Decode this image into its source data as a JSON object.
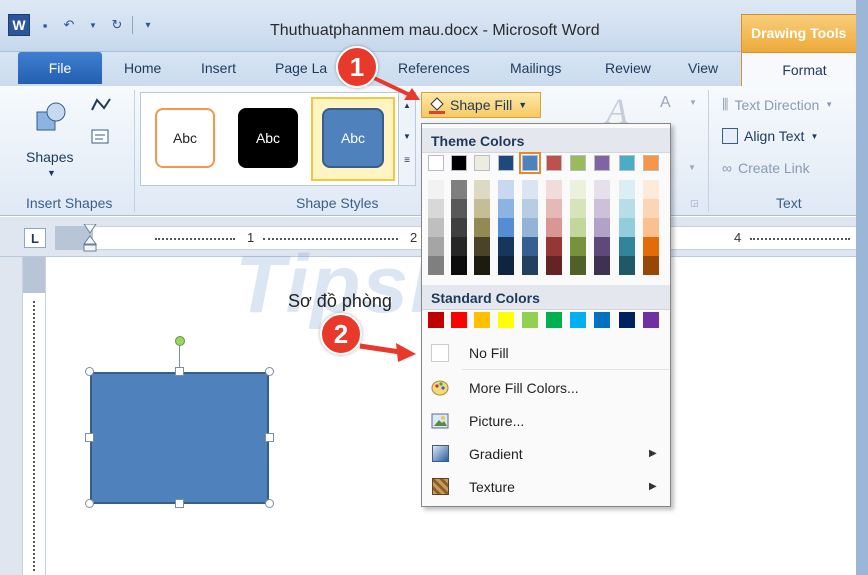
{
  "window": {
    "title": "Thuthuatphanmem mau.docx - Microsoft Word",
    "word_logo": "W"
  },
  "contextual_tab": {
    "label": "Drawing Tools"
  },
  "tabs": [
    {
      "label": "File"
    },
    {
      "label": "Home"
    },
    {
      "label": "Insert"
    },
    {
      "label": "Page La"
    },
    {
      "label": "References"
    },
    {
      "label": "Mailings"
    },
    {
      "label": "Review"
    },
    {
      "label": "View"
    },
    {
      "label": "Format"
    }
  ],
  "ribbon": {
    "insert_shapes": {
      "shapes_label": "Shapes",
      "group_label": "Insert Shapes"
    },
    "shape_styles": {
      "group_label": "Shape Styles",
      "styles": [
        {
          "label": "Abc"
        },
        {
          "label": "Abc"
        },
        {
          "label": "Abc"
        }
      ],
      "shape_fill_label": "Shape Fill"
    },
    "text": {
      "text_direction": "Text Direction",
      "align_text": "Align Text",
      "create_link": "Create Link",
      "group_label": "Text"
    }
  },
  "ruler_numbers": [
    "1",
    "2",
    "4"
  ],
  "document": {
    "heading": "Sơ đồ phòng"
  },
  "shape_fill_menu": {
    "theme_colors_label": "Theme Colors",
    "standard_colors_label": "Standard Colors",
    "theme_colors": [
      [
        "#ffffff",
        "#f2f2f2",
        "#d8d8d8",
        "#bfbfbf",
        "#a5a5a5",
        "#7f7f7f"
      ],
      [
        "#000000",
        "#7f7f7f",
        "#595959",
        "#3f3f3f",
        "#262626",
        "#0c0c0c"
      ],
      [
        "#eeece1",
        "#ddd9c3",
        "#c4bd97",
        "#938953",
        "#494429",
        "#1d1b10"
      ],
      [
        "#1f497d",
        "#c6d9f0",
        "#8db3e2",
        "#548dd4",
        "#17365d",
        "#0f243e"
      ],
      [
        "#4f81bd",
        "#dbe5f1",
        "#b8cce4",
        "#95b3d7",
        "#366092",
        "#244061"
      ],
      [
        "#c0504d",
        "#f2dcdb",
        "#e5b9b7",
        "#d99694",
        "#953734",
        "#632423"
      ],
      [
        "#9bbb59",
        "#ebf1dd",
        "#d7e3bc",
        "#c3d69b",
        "#76923c",
        "#4f6128"
      ],
      [
        "#8064a2",
        "#e5e0ec",
        "#ccc1d9",
        "#b2a2c7",
        "#5f497a",
        "#3f3151"
      ],
      [
        "#4bacc6",
        "#dbeef3",
        "#b7dde8",
        "#92cddc",
        "#31859b",
        "#205867"
      ],
      [
        "#f79646",
        "#fdeada",
        "#fbd5b5",
        "#fac08f",
        "#e36c09",
        "#974806"
      ]
    ],
    "standard_colors": [
      "#c00000",
      "#ff0000",
      "#ffc000",
      "#ffff00",
      "#92d050",
      "#00b050",
      "#00b0f0",
      "#0070c0",
      "#002060",
      "#7030a0"
    ],
    "items": [
      {
        "label": "No Fill",
        "icon": "no-fill-icon"
      },
      {
        "label": "More Fill Colors...",
        "icon": "palette-icon"
      },
      {
        "label": "Picture...",
        "icon": "picture-icon"
      },
      {
        "label": "Gradient",
        "icon": "gradient-icon"
      },
      {
        "label": "Texture",
        "icon": "texture-icon"
      }
    ]
  },
  "annotations": [
    {
      "label": "1"
    },
    {
      "label": "2"
    }
  ],
  "watermark": "TipsMake",
  "colors": {
    "accent": "#e8392b",
    "shape_fill": "#4f81bd",
    "contextual": "#f0b040"
  }
}
